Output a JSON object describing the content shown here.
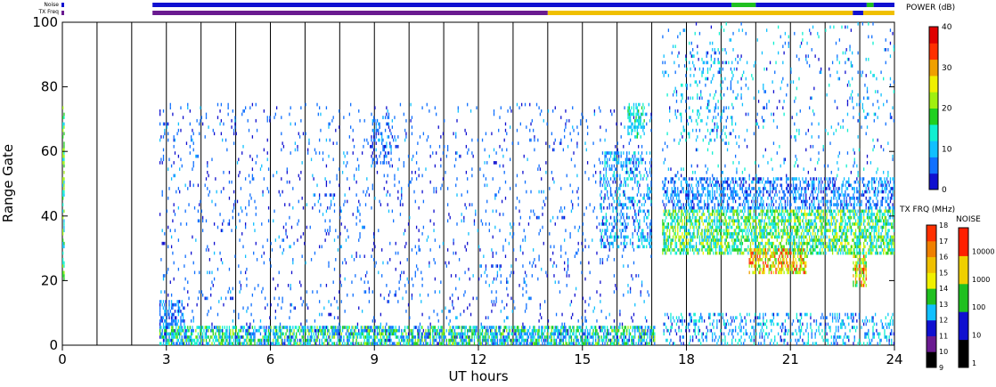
{
  "strip_labels": {
    "noise": "Noise",
    "tx_freq": "TX Freq"
  },
  "chart_data": {
    "type": "heatmap",
    "xlabel": "UT hours",
    "ylabel": "Range Gate",
    "xlim": [
      0,
      24
    ],
    "ylim": [
      0,
      100
    ],
    "x_ticks": [
      0,
      3,
      6,
      9,
      12,
      15,
      18,
      21,
      24
    ],
    "y_ticks": [
      0,
      20,
      40,
      60,
      80,
      100
    ],
    "grid": "vertical lines every hour",
    "power_scale": {
      "title": "POWER (dB)",
      "ticks": [
        0,
        10,
        20,
        30,
        40
      ],
      "colors": [
        "#1010d0",
        "#1070ff",
        "#10c0ff",
        "#10f0d0",
        "#20d020",
        "#a0f010",
        "#f0f000",
        "#f0a000",
        "#ff3000",
        "#e00000"
      ]
    },
    "tx_freq_scale": {
      "title": "TX FRQ (MHz)",
      "ticks": [
        9,
        10,
        11,
        12,
        13,
        14,
        15,
        16,
        17,
        18
      ],
      "colors": [
        "#000000",
        "#6a1a90",
        "#1010d0",
        "#10c0ff",
        "#20c020",
        "#f0f000",
        "#f0c000",
        "#f08000",
        "#ff3000"
      ]
    },
    "noise_scale": {
      "title": "NOISE",
      "ticks": [
        1,
        10,
        100,
        1000,
        10000
      ],
      "colors": [
        "#000000",
        "#1010d0",
        "#20c020",
        "#f0d000",
        "#ff2000"
      ]
    },
    "noise_strip": [
      {
        "from": 2.6,
        "to": 19.3,
        "level": "blue"
      },
      {
        "from": 19.3,
        "to": 20.0,
        "level": "green"
      },
      {
        "from": 20.0,
        "to": 23.2,
        "level": "blue"
      },
      {
        "from": 23.2,
        "to": 23.4,
        "level": "green"
      },
      {
        "from": 23.4,
        "to": 24.0,
        "level": "blue"
      }
    ],
    "tx_freq_strip": [
      {
        "from": 2.6,
        "to": 14.0,
        "mhz": 10
      },
      {
        "from": 14.0,
        "to": 22.8,
        "mhz": 15
      },
      {
        "from": 22.8,
        "to": 23.1,
        "mhz": 11
      },
      {
        "from": 23.1,
        "to": 24.0,
        "mhz": 15
      }
    ],
    "regions": [
      {
        "x": [
          0.0,
          0.05
        ],
        "gates": [
          20,
          75
        ],
        "power": [
          8,
          24
        ],
        "density": 0.6
      },
      {
        "x": [
          2.8,
          17.1
        ],
        "gates": [
          0,
          6
        ],
        "power": [
          3,
          22
        ],
        "density": 0.65
      },
      {
        "x": [
          2.8,
          3.5
        ],
        "gates": [
          6,
          14
        ],
        "power": [
          2,
          10
        ],
        "density": 0.5
      },
      {
        "x": [
          2.8,
          17.0
        ],
        "gates": [
          6,
          75
        ],
        "power": [
          2,
          9
        ],
        "density": 0.05
      },
      {
        "x": [
          8.9,
          9.5
        ],
        "gates": [
          55,
          72
        ],
        "power": [
          2,
          9
        ],
        "density": 0.3
      },
      {
        "x": [
          15.5,
          17.0
        ],
        "gates": [
          30,
          60
        ],
        "power": [
          3,
          14
        ],
        "density": 0.3
      },
      {
        "x": [
          16.3,
          16.8
        ],
        "gates": [
          64,
          75
        ],
        "power": [
          8,
          18
        ],
        "density": 0.5
      },
      {
        "x": [
          17.3,
          24.0
        ],
        "gates": [
          42,
          52
        ],
        "power": [
          2,
          12
        ],
        "density": 0.45
      },
      {
        "x": [
          17.3,
          24.0
        ],
        "gates": [
          28,
          42
        ],
        "power": [
          8,
          26
        ],
        "density": 0.6
      },
      {
        "x": [
          19.8,
          21.5
        ],
        "gates": [
          22,
          30
        ],
        "power": [
          18,
          36
        ],
        "density": 0.6
      },
      {
        "x": [
          22.8,
          23.2
        ],
        "gates": [
          18,
          28
        ],
        "power": [
          14,
          34
        ],
        "density": 0.6
      },
      {
        "x": [
          17.3,
          24.0
        ],
        "gates": [
          0,
          10
        ],
        "power": [
          2,
          16
        ],
        "density": 0.25
      },
      {
        "x": [
          17.3,
          24.0
        ],
        "gates": [
          52,
          100
        ],
        "power": [
          2,
          14
        ],
        "density": 0.05
      },
      {
        "x": [
          17.8,
          19.5
        ],
        "gates": [
          62,
          92
        ],
        "power": [
          5,
          16
        ],
        "density": 0.1
      }
    ]
  }
}
